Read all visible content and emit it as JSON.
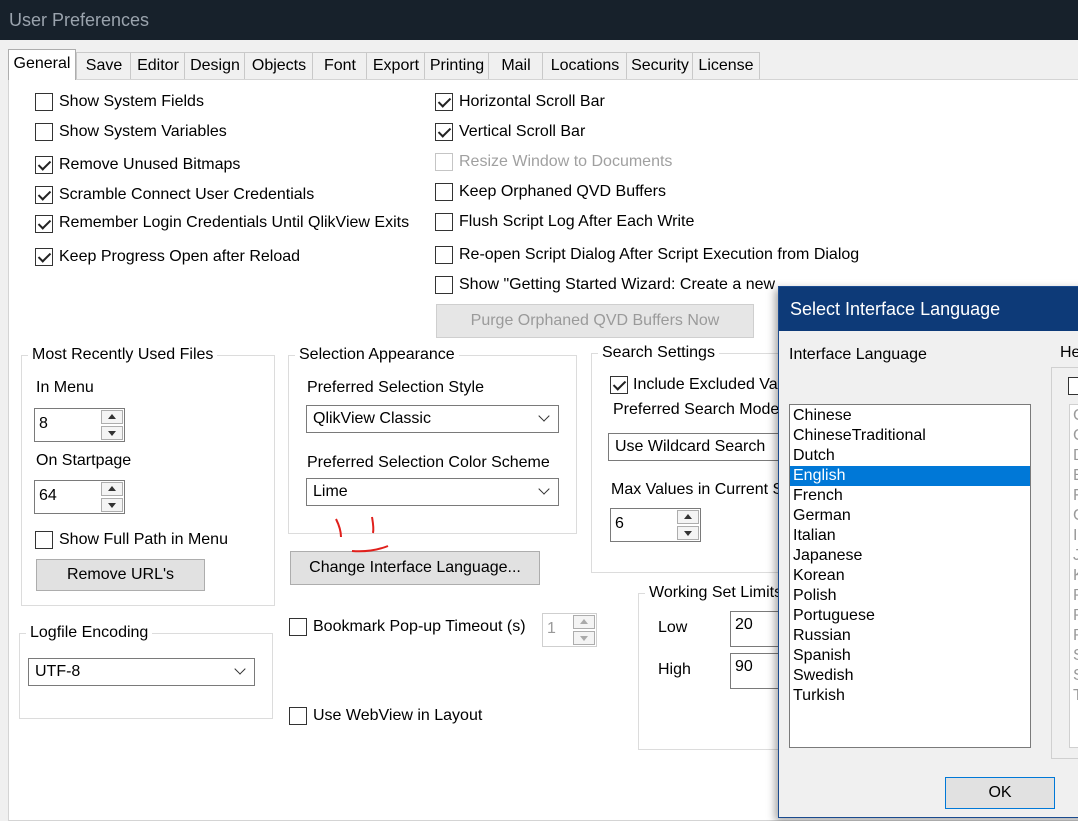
{
  "window": {
    "title": "User Preferences"
  },
  "tabs": [
    "General",
    "Save",
    "Editor",
    "Design",
    "Objects",
    "Font",
    "Export",
    "Printing",
    "Mail",
    "Locations",
    "Security",
    "License"
  ],
  "left_checks": [
    {
      "label": "Show System Fields",
      "checked": false
    },
    {
      "label": "Show System Variables",
      "checked": false
    },
    {
      "label": "Remove Unused Bitmaps",
      "checked": true
    },
    {
      "label": "Scramble Connect User Credentials",
      "checked": true
    },
    {
      "label": "Remember Login Credentials Until QlikView Exits",
      "checked": true
    },
    {
      "label": "Keep Progress Open after Reload",
      "checked": true
    }
  ],
  "right_checks": [
    {
      "label": "Horizontal Scroll Bar",
      "checked": true
    },
    {
      "label": "Vertical Scroll Bar",
      "checked": true
    },
    {
      "label": "Resize Window to Documents",
      "checked": false,
      "disabled": true
    },
    {
      "label": "Keep Orphaned QVD Buffers",
      "checked": false
    },
    {
      "label": "Flush Script Log After Each Write",
      "checked": false
    },
    {
      "label": "Re-open Script Dialog After Script Execution from Dialog",
      "checked": false
    },
    {
      "label": "Show \"Getting Started Wizard: Create a new document\" when creating new document",
      "checked": false
    }
  ],
  "purge_button": "Purge Orphaned QVD Buffers Now",
  "mru": {
    "title": "Most Recently Used Files",
    "in_menu_label": "In Menu",
    "in_menu_value": "8",
    "on_startpage_label": "On Startpage",
    "on_startpage_value": "64",
    "show_full_path": "Show Full Path in Menu",
    "remove_urls": "Remove URL's"
  },
  "logfile": {
    "title": "Logfile Encoding",
    "value": "UTF-8"
  },
  "selection": {
    "title": "Selection Appearance",
    "style_label": "Preferred Selection Style",
    "style_value": "QlikView Classic",
    "color_label": "Preferred Selection Color Scheme",
    "color_value": "Lime"
  },
  "change_language_button": "Change Interface Language...",
  "bookmark": {
    "label": "Bookmark Pop-up Timeout (s)",
    "value": "1"
  },
  "webview": {
    "label": "Use WebView in Layout"
  },
  "search": {
    "title": "Search Settings",
    "include_excluded": "Include Excluded Va",
    "mode_label": "Preferred Search Mode",
    "mode_value": "Use Wildcard Search",
    "max_values_label": "Max Values in Current S",
    "max_values_value": "6"
  },
  "working_set": {
    "title": "Working Set Limits",
    "low_label": "Low",
    "low_value": "20",
    "high_label": "High",
    "high_value": "90"
  },
  "dialog": {
    "title": "Select Interface Language",
    "list_label": "Interface Language",
    "help_label": "He",
    "languages": [
      "Chinese",
      "ChineseTraditional",
      "Dutch",
      "English",
      "French",
      "German",
      "Italian",
      "Japanese",
      "Korean",
      "Polish",
      "Portuguese",
      "Russian",
      "Spanish",
      "Swedish",
      "Turkish"
    ],
    "selected": "English",
    "help_letters": [
      "C",
      "C",
      "D",
      "E",
      "F",
      "G",
      "I",
      "J",
      "K",
      "P",
      "P",
      "R",
      "S",
      "S",
      "T"
    ],
    "ok": "OK"
  },
  "colors": {
    "titlebar": "#17212b",
    "dialog_title": "#0d3a78",
    "selection": "#0078d7",
    "annotation": "#e0201c"
  }
}
